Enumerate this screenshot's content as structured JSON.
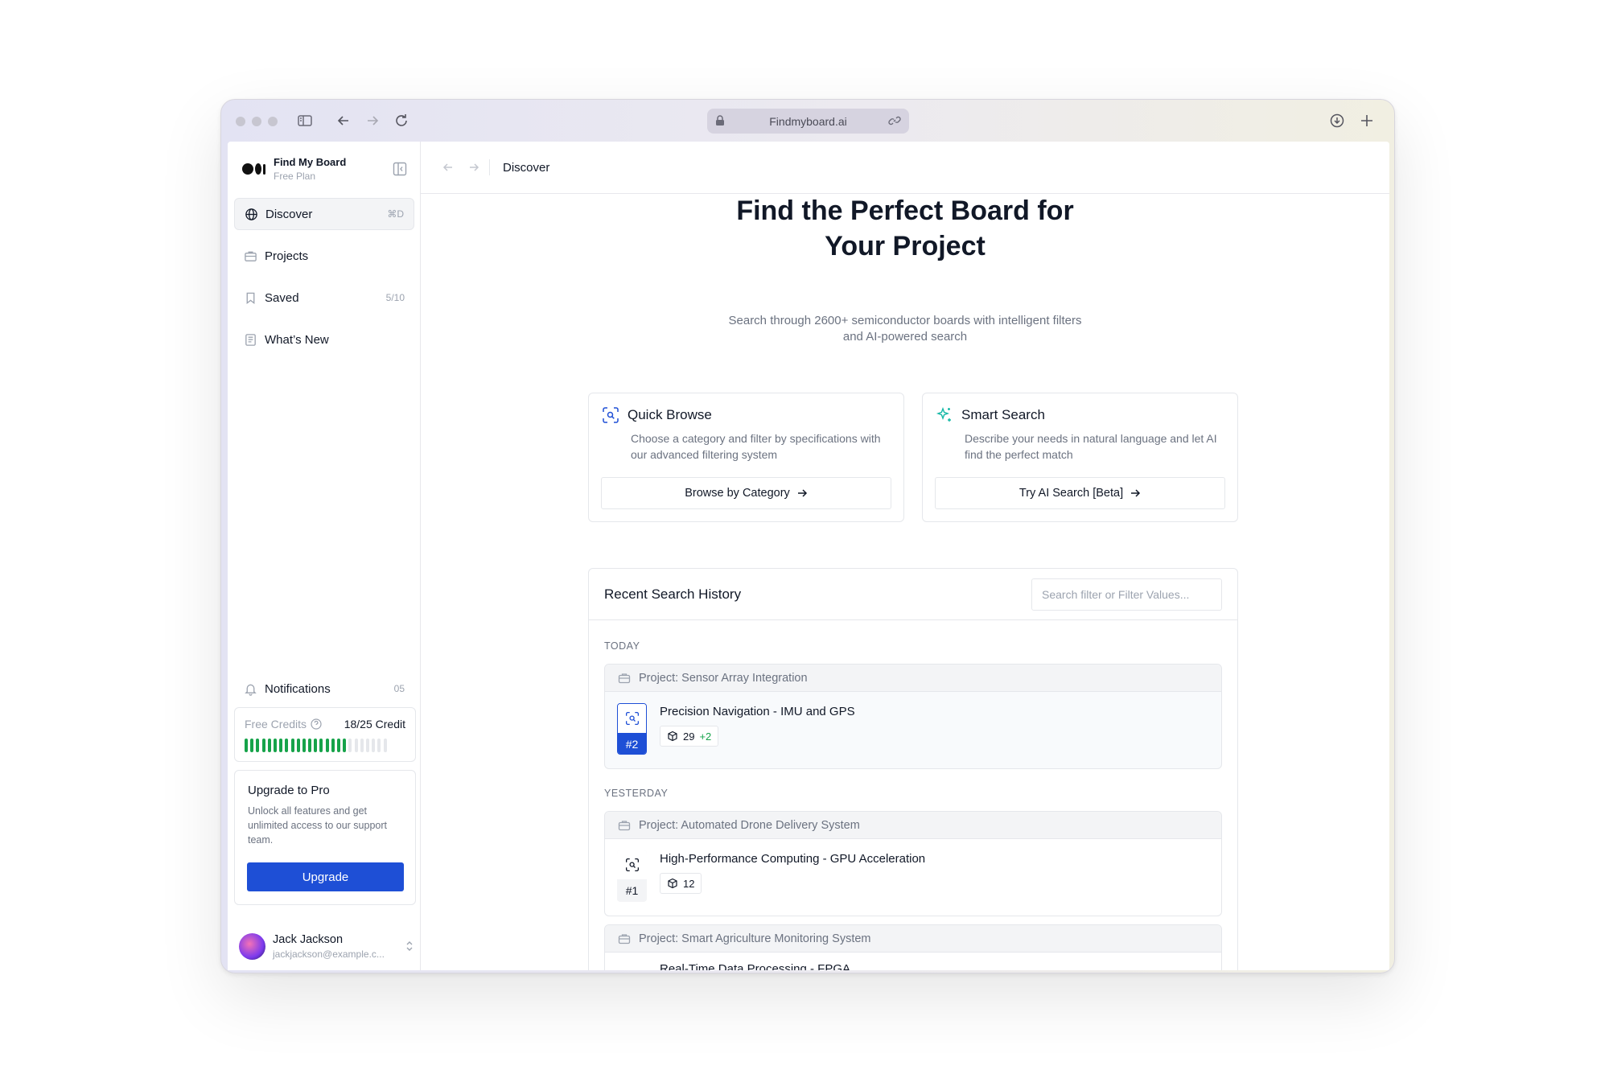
{
  "browser": {
    "url": "Findmyboard.ai"
  },
  "app": {
    "name": "Find My Board",
    "plan": "Free Plan"
  },
  "sidebar": {
    "items": [
      {
        "label": "Discover",
        "shortcut": "⌘D",
        "icon": "globe-icon"
      },
      {
        "label": "Projects",
        "shortcut": "",
        "icon": "briefcase-icon"
      },
      {
        "label": "Saved",
        "shortcut": "5/10",
        "icon": "bookmark-icon"
      },
      {
        "label": "What’s New",
        "shortcut": "",
        "icon": "newspaper-icon"
      }
    ],
    "notifications": {
      "label": "Notifications",
      "count": "05"
    },
    "credits": {
      "label": "Free Credits",
      "value": "18/25 Credit",
      "used": 18,
      "total": 25
    },
    "upgrade": {
      "title": "Upgrade to Pro",
      "text": "Unlock all features and get unlimited access to our support team.",
      "button": "Upgrade"
    },
    "user": {
      "name": "Jack Jackson",
      "email": "jackjackson@example.c..."
    }
  },
  "topbar": {
    "breadcrumb": "Discover"
  },
  "hero": {
    "title": "Find the Perfect Board for Your Project",
    "subtitle": "Search through 2600+ semiconductor boards with intelligent filters and AI-powered search"
  },
  "cards": [
    {
      "title": "Quick Browse",
      "desc": "Choose a category and filter by specifications with our advanced filtering system",
      "button": "Browse by Category",
      "icon": "scan-search-icon"
    },
    {
      "title": "Smart Search",
      "desc": "Describe your needs in natural language and let AI find the perfect match",
      "button": "Try AI Search [Beta]",
      "icon": "sparkles-icon"
    }
  ],
  "history": {
    "title": "Recent Search History",
    "search_placeholder": "Search filter or Filter Values...",
    "groups": [
      {
        "day": "TODAY",
        "project": "Project: Sensor Array Integration",
        "entry": {
          "title": "Precision Navigation - IMU and GPS",
          "rank": "#2",
          "count": "29",
          "extra": "+2"
        }
      },
      {
        "day": "YESTERDAY",
        "project": "Project: Automated Drone Delivery System",
        "entry": {
          "title": "High-Performance Computing - GPU Acceleration",
          "rank": "#1",
          "count": "12",
          "extra": ""
        }
      },
      {
        "day": "",
        "project": "Project: Smart Agriculture Monitoring System",
        "entry": {
          "title": "Real-Time Data Processing - FPGA",
          "rank": "",
          "count": "",
          "extra": ""
        }
      }
    ]
  },
  "colors": {
    "accent": "#1e4fd6",
    "success": "#16a34a",
    "smart_icon": "#14b8a6"
  }
}
